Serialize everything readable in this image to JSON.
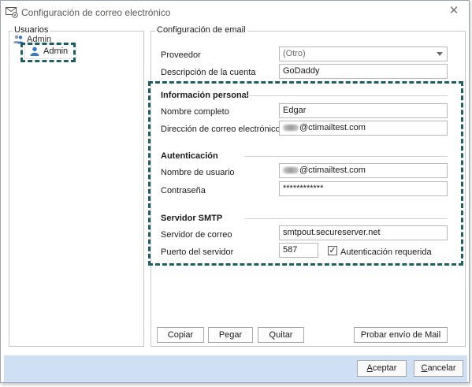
{
  "window": {
    "title": "Configuración de correo electrónico",
    "close_icon": "close-icon"
  },
  "users": {
    "legend": "Usuarios",
    "root_label": "Admin",
    "child_label": "Admin"
  },
  "email": {
    "legend": "Configuración de email",
    "provider_label": "Proveedor",
    "provider_value": "(Otro)",
    "description_label": "Descripción de la cuenta",
    "description_value": "GoDaddy",
    "personal_title": "Información personal",
    "fullname_label": "Nombre completo",
    "fullname_value": "Edgar",
    "address_label": "Dirección de correo electrónico",
    "address_value": "@ctimailtest.com",
    "auth_title": "Autenticación",
    "username_label": "Nombre de usuario",
    "username_value": "@ctimailtest.com",
    "password_label": "Contraseña",
    "password_value": "************",
    "smtp_title": "Servidor SMTP",
    "server_label": "Servidor de correo",
    "server_value": "smtpout.secureserver.net",
    "port_label": "Puerto del servidor",
    "port_value": "587",
    "auth_required_label": "Autenticación requerida",
    "auth_required_checked": true
  },
  "actions": {
    "copy": "Copiar",
    "paste": "Pegar",
    "remove": "Quitar",
    "test_send": "Probar envío de Mail"
  },
  "footer": {
    "accept_underlined": "A",
    "accept_rest": "ceptar",
    "cancel_underlined": "C",
    "cancel_rest": "ancelar"
  },
  "colors": {
    "highlight": "#1e5f60",
    "footer_bg": "#cfe0f4",
    "user_icon": "#3b78c4"
  }
}
